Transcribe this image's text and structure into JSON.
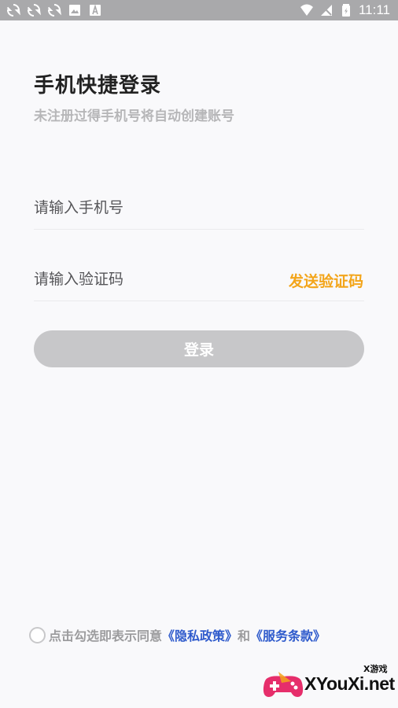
{
  "status_bar": {
    "time": "11:11",
    "left_icons": [
      "sync-icon",
      "sync-icon",
      "sync-icon",
      "image-icon",
      "font-icon"
    ],
    "right_icons": [
      "wifi-icon",
      "no-sim-icon",
      "battery-icon"
    ]
  },
  "page": {
    "title": "手机快捷登录",
    "subtitle": "未注册过得手机号将自动创建账号"
  },
  "form": {
    "phone_placeholder": "请输入手机号",
    "code_placeholder": "请输入验证码",
    "send_code_label": "发送验证码",
    "login_label": "登录"
  },
  "agreement": {
    "checked": false,
    "prefix": "点击勾选即表示同意",
    "privacy_link": "《隐私政策》",
    "conjunction": "和",
    "terms_link": "《服务条款》"
  },
  "watermark": {
    "small_text": "X游戏",
    "text": "XYouXi.net"
  },
  "colors": {
    "accent": "#f3a51a",
    "link": "#2f5bcc",
    "button_disabled": "#c7c7c9",
    "status_bar": "#a9a9ab"
  }
}
